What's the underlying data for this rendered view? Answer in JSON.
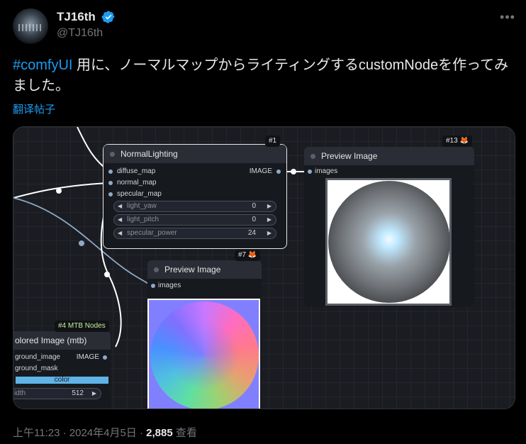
{
  "author": {
    "display_name": "TJ16th",
    "handle": "@TJ16th",
    "verified": true,
    "avatar_icon": "avatar-image"
  },
  "more_icon": "more-options-icon",
  "tweet": {
    "hashtag": "#comfyUI",
    "text": " 用に、ノーマルマップからライティングするcustomNodeを作ってみました。",
    "translate_label": "翻译帖子"
  },
  "comfy": {
    "accent_colors": {
      "wire": "#ffffff",
      "port": "#8fa9c8",
      "color_widget": "#5fb3e6"
    },
    "normal_lighting": {
      "badge": "#1",
      "title": "NormalLighting",
      "inputs": [
        "diffuse_map",
        "normal_map",
        "specular_map"
      ],
      "output": "IMAGE",
      "widgets": [
        {
          "label": "light_yaw",
          "value": "0"
        },
        {
          "label": "light_pitch",
          "value": "0"
        },
        {
          "label": "specular_power",
          "value": "24"
        }
      ]
    },
    "preview_13": {
      "badge": "#13 🦊",
      "title": "Preview Image",
      "input": "images"
    },
    "preview_7": {
      "badge": "#7 🦊",
      "title": "Preview Image",
      "input": "images"
    },
    "colored_image": {
      "badge": "#4 MTB Nodes",
      "title": "olored Image (mtb)",
      "ports": [
        "ground_image",
        "ground_mask"
      ],
      "output": "IMAGE",
      "color_label": "color",
      "width_label": "idth",
      "width_value": "512"
    }
  },
  "footer": {
    "time": "上午11:23 · 2024年4月5日 · ",
    "views": "2,885",
    "views_label": " 查看"
  }
}
